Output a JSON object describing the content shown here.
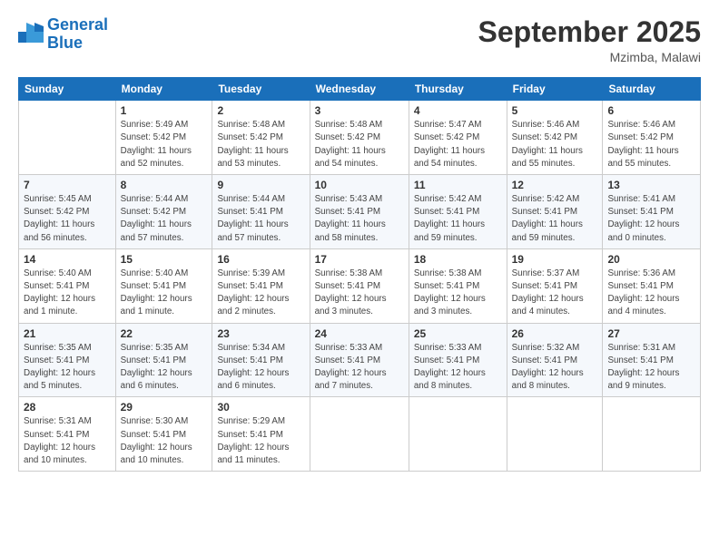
{
  "header": {
    "logo_line1": "General",
    "logo_line2": "Blue",
    "month": "September 2025",
    "location": "Mzimba, Malawi"
  },
  "weekdays": [
    "Sunday",
    "Monday",
    "Tuesday",
    "Wednesday",
    "Thursday",
    "Friday",
    "Saturday"
  ],
  "weeks": [
    [
      {
        "day": "",
        "info": ""
      },
      {
        "day": "1",
        "info": "Sunrise: 5:49 AM\nSunset: 5:42 PM\nDaylight: 11 hours\nand 52 minutes."
      },
      {
        "day": "2",
        "info": "Sunrise: 5:48 AM\nSunset: 5:42 PM\nDaylight: 11 hours\nand 53 minutes."
      },
      {
        "day": "3",
        "info": "Sunrise: 5:48 AM\nSunset: 5:42 PM\nDaylight: 11 hours\nand 54 minutes."
      },
      {
        "day": "4",
        "info": "Sunrise: 5:47 AM\nSunset: 5:42 PM\nDaylight: 11 hours\nand 54 minutes."
      },
      {
        "day": "5",
        "info": "Sunrise: 5:46 AM\nSunset: 5:42 PM\nDaylight: 11 hours\nand 55 minutes."
      },
      {
        "day": "6",
        "info": "Sunrise: 5:46 AM\nSunset: 5:42 PM\nDaylight: 11 hours\nand 55 minutes."
      }
    ],
    [
      {
        "day": "7",
        "info": "Sunrise: 5:45 AM\nSunset: 5:42 PM\nDaylight: 11 hours\nand 56 minutes."
      },
      {
        "day": "8",
        "info": "Sunrise: 5:44 AM\nSunset: 5:42 PM\nDaylight: 11 hours\nand 57 minutes."
      },
      {
        "day": "9",
        "info": "Sunrise: 5:44 AM\nSunset: 5:41 PM\nDaylight: 11 hours\nand 57 minutes."
      },
      {
        "day": "10",
        "info": "Sunrise: 5:43 AM\nSunset: 5:41 PM\nDaylight: 11 hours\nand 58 minutes."
      },
      {
        "day": "11",
        "info": "Sunrise: 5:42 AM\nSunset: 5:41 PM\nDaylight: 11 hours\nand 59 minutes."
      },
      {
        "day": "12",
        "info": "Sunrise: 5:42 AM\nSunset: 5:41 PM\nDaylight: 11 hours\nand 59 minutes."
      },
      {
        "day": "13",
        "info": "Sunrise: 5:41 AM\nSunset: 5:41 PM\nDaylight: 12 hours\nand 0 minutes."
      }
    ],
    [
      {
        "day": "14",
        "info": "Sunrise: 5:40 AM\nSunset: 5:41 PM\nDaylight: 12 hours\nand 1 minute."
      },
      {
        "day": "15",
        "info": "Sunrise: 5:40 AM\nSunset: 5:41 PM\nDaylight: 12 hours\nand 1 minute."
      },
      {
        "day": "16",
        "info": "Sunrise: 5:39 AM\nSunset: 5:41 PM\nDaylight: 12 hours\nand 2 minutes."
      },
      {
        "day": "17",
        "info": "Sunrise: 5:38 AM\nSunset: 5:41 PM\nDaylight: 12 hours\nand 3 minutes."
      },
      {
        "day": "18",
        "info": "Sunrise: 5:38 AM\nSunset: 5:41 PM\nDaylight: 12 hours\nand 3 minutes."
      },
      {
        "day": "19",
        "info": "Sunrise: 5:37 AM\nSunset: 5:41 PM\nDaylight: 12 hours\nand 4 minutes."
      },
      {
        "day": "20",
        "info": "Sunrise: 5:36 AM\nSunset: 5:41 PM\nDaylight: 12 hours\nand 4 minutes."
      }
    ],
    [
      {
        "day": "21",
        "info": "Sunrise: 5:35 AM\nSunset: 5:41 PM\nDaylight: 12 hours\nand 5 minutes."
      },
      {
        "day": "22",
        "info": "Sunrise: 5:35 AM\nSunset: 5:41 PM\nDaylight: 12 hours\nand 6 minutes."
      },
      {
        "day": "23",
        "info": "Sunrise: 5:34 AM\nSunset: 5:41 PM\nDaylight: 12 hours\nand 6 minutes."
      },
      {
        "day": "24",
        "info": "Sunrise: 5:33 AM\nSunset: 5:41 PM\nDaylight: 12 hours\nand 7 minutes."
      },
      {
        "day": "25",
        "info": "Sunrise: 5:33 AM\nSunset: 5:41 PM\nDaylight: 12 hours\nand 8 minutes."
      },
      {
        "day": "26",
        "info": "Sunrise: 5:32 AM\nSunset: 5:41 PM\nDaylight: 12 hours\nand 8 minutes."
      },
      {
        "day": "27",
        "info": "Sunrise: 5:31 AM\nSunset: 5:41 PM\nDaylight: 12 hours\nand 9 minutes."
      }
    ],
    [
      {
        "day": "28",
        "info": "Sunrise: 5:31 AM\nSunset: 5:41 PM\nDaylight: 12 hours\nand 10 minutes."
      },
      {
        "day": "29",
        "info": "Sunrise: 5:30 AM\nSunset: 5:41 PM\nDaylight: 12 hours\nand 10 minutes."
      },
      {
        "day": "30",
        "info": "Sunrise: 5:29 AM\nSunset: 5:41 PM\nDaylight: 12 hours\nand 11 minutes."
      },
      {
        "day": "",
        "info": ""
      },
      {
        "day": "",
        "info": ""
      },
      {
        "day": "",
        "info": ""
      },
      {
        "day": "",
        "info": ""
      }
    ]
  ]
}
